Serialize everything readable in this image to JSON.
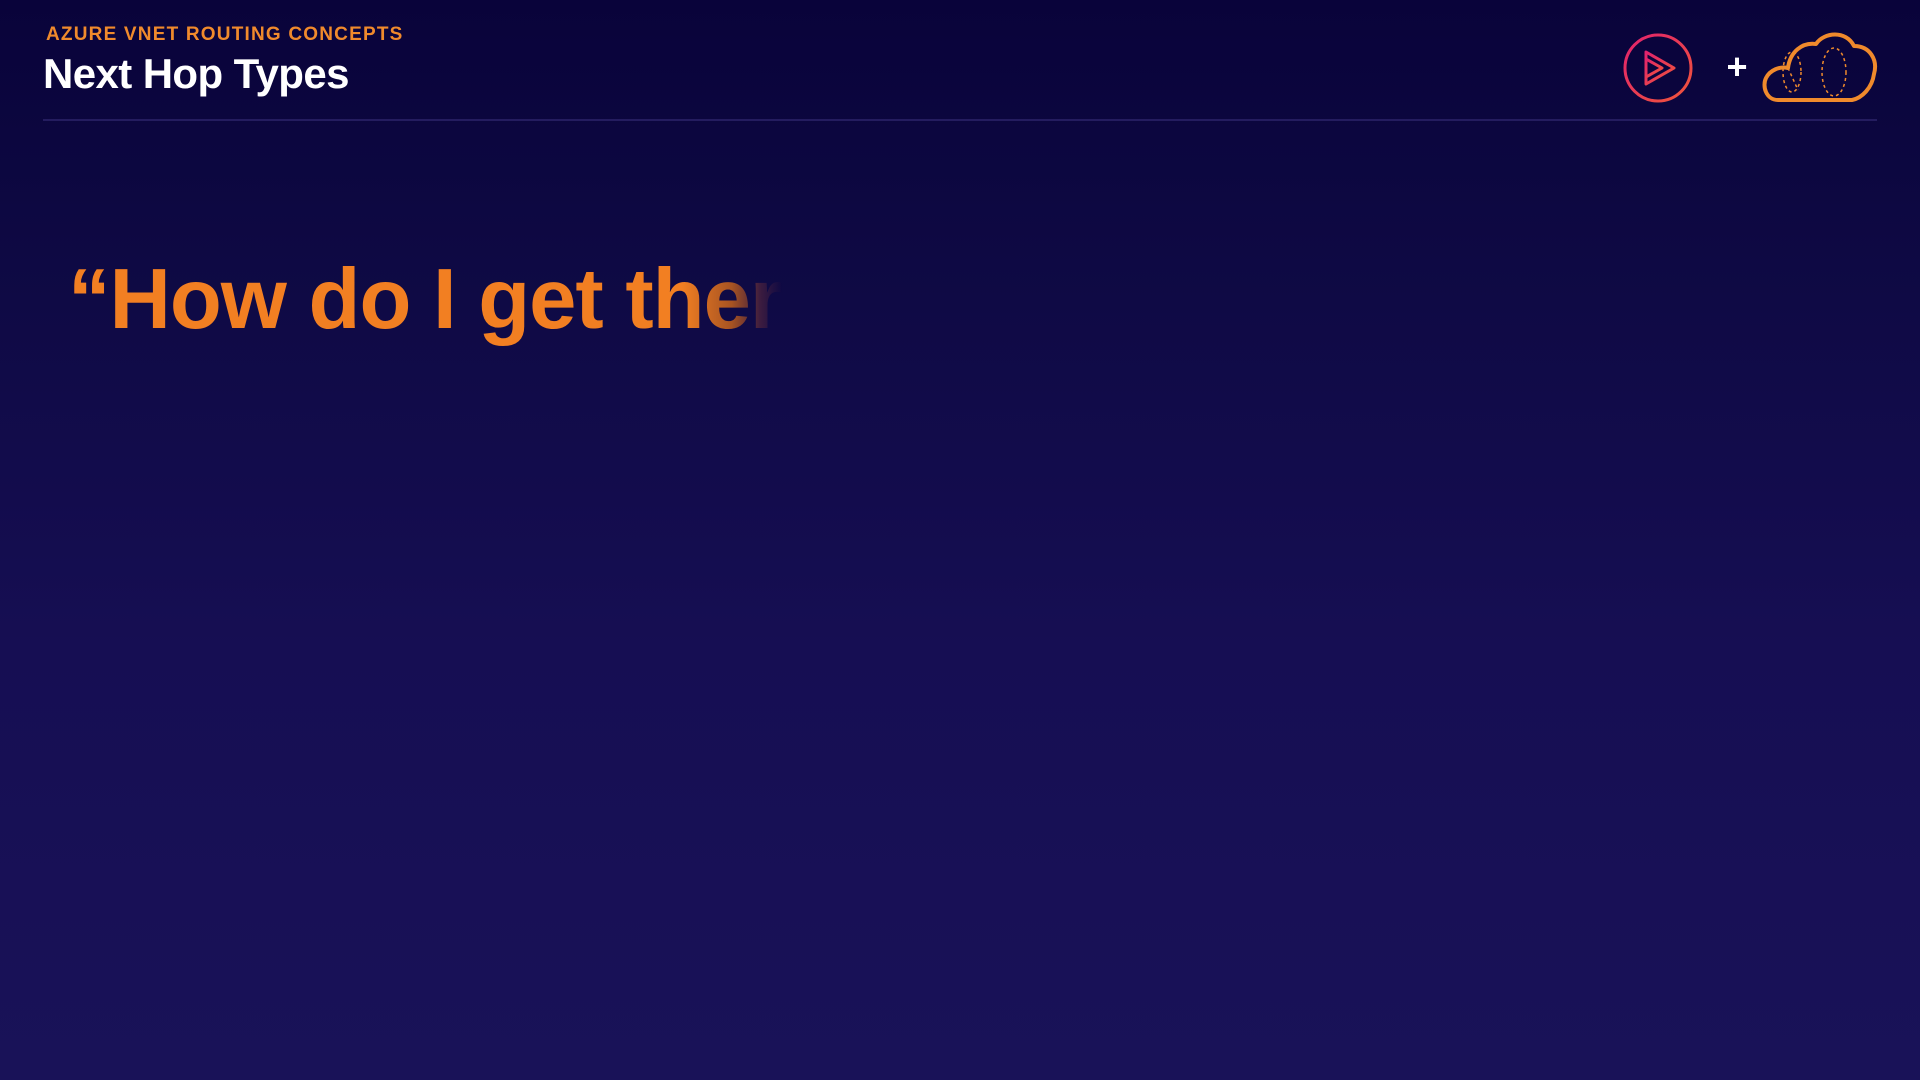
{
  "header": {
    "kicker": "AZURE VNET ROUTING CONCEPTS",
    "title": "Next Hop Types"
  },
  "logos": {
    "play_logo": "play-triangle-icon",
    "plus": "+",
    "cloud_logo": "cloud-icon"
  },
  "main": {
    "quote": "“How do I get ther"
  },
  "colors": {
    "accent": "#f27f22",
    "title": "#ffffff",
    "background_top": "#09033a",
    "background_bottom": "#191258",
    "play_gradient_start": "#e1226e",
    "play_gradient_end": "#f0553a"
  }
}
